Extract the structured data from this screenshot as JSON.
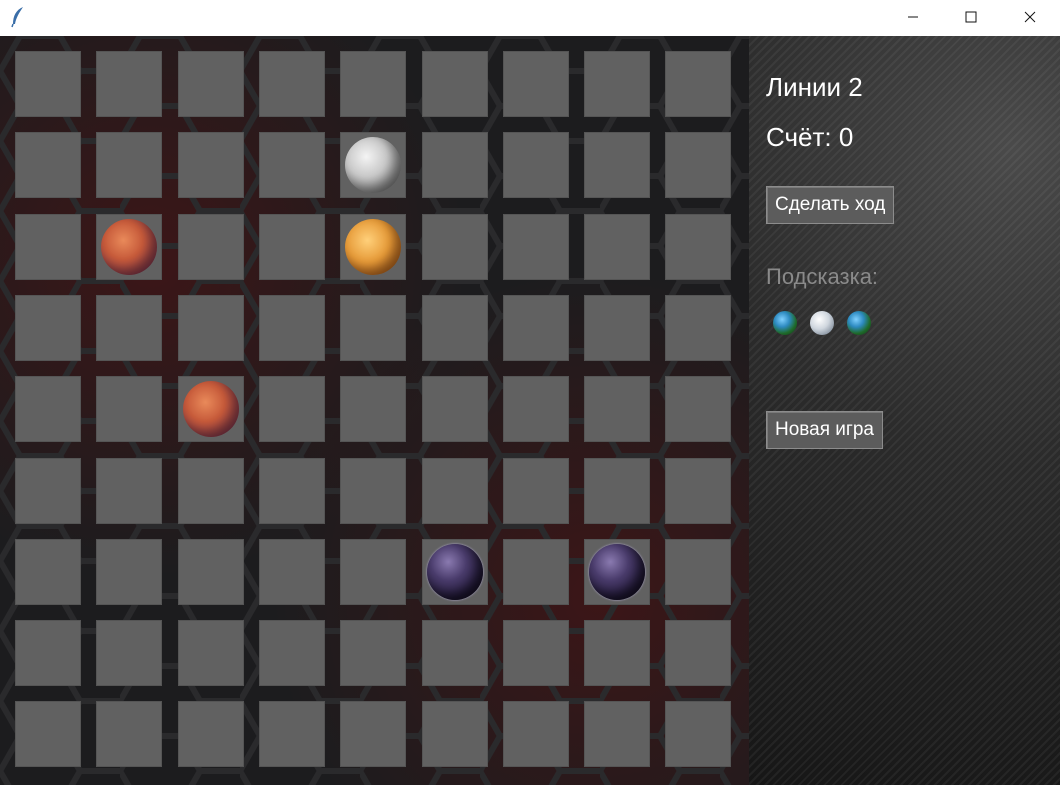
{
  "window": {
    "icon": "feather-icon",
    "controls": [
      "minimize-icon",
      "maximize-icon",
      "close-icon"
    ]
  },
  "board": {
    "rows": 9,
    "cols": 9,
    "pieces": [
      {
        "row": 1,
        "col": 4,
        "kind": "moon"
      },
      {
        "row": 2,
        "col": 1,
        "kind": "mars"
      },
      {
        "row": 2,
        "col": 4,
        "kind": "venus"
      },
      {
        "row": 4,
        "col": 2,
        "kind": "mars"
      },
      {
        "row": 6,
        "col": 5,
        "kind": "dark"
      },
      {
        "row": 6,
        "col": 7,
        "kind": "dark"
      }
    ]
  },
  "panel": {
    "title": "Линии 2",
    "score": "Счёт: 0",
    "move_button": "Сделать ход",
    "hint_label": "Подсказка:",
    "hints": [
      "earth",
      "moon",
      "earth"
    ],
    "new_game_button": "Новая игра"
  },
  "colors": {
    "cell": "#616161",
    "board_bg": "#1c1c1e",
    "text": "#ffffff",
    "hint_text": "#8a8a8a"
  }
}
